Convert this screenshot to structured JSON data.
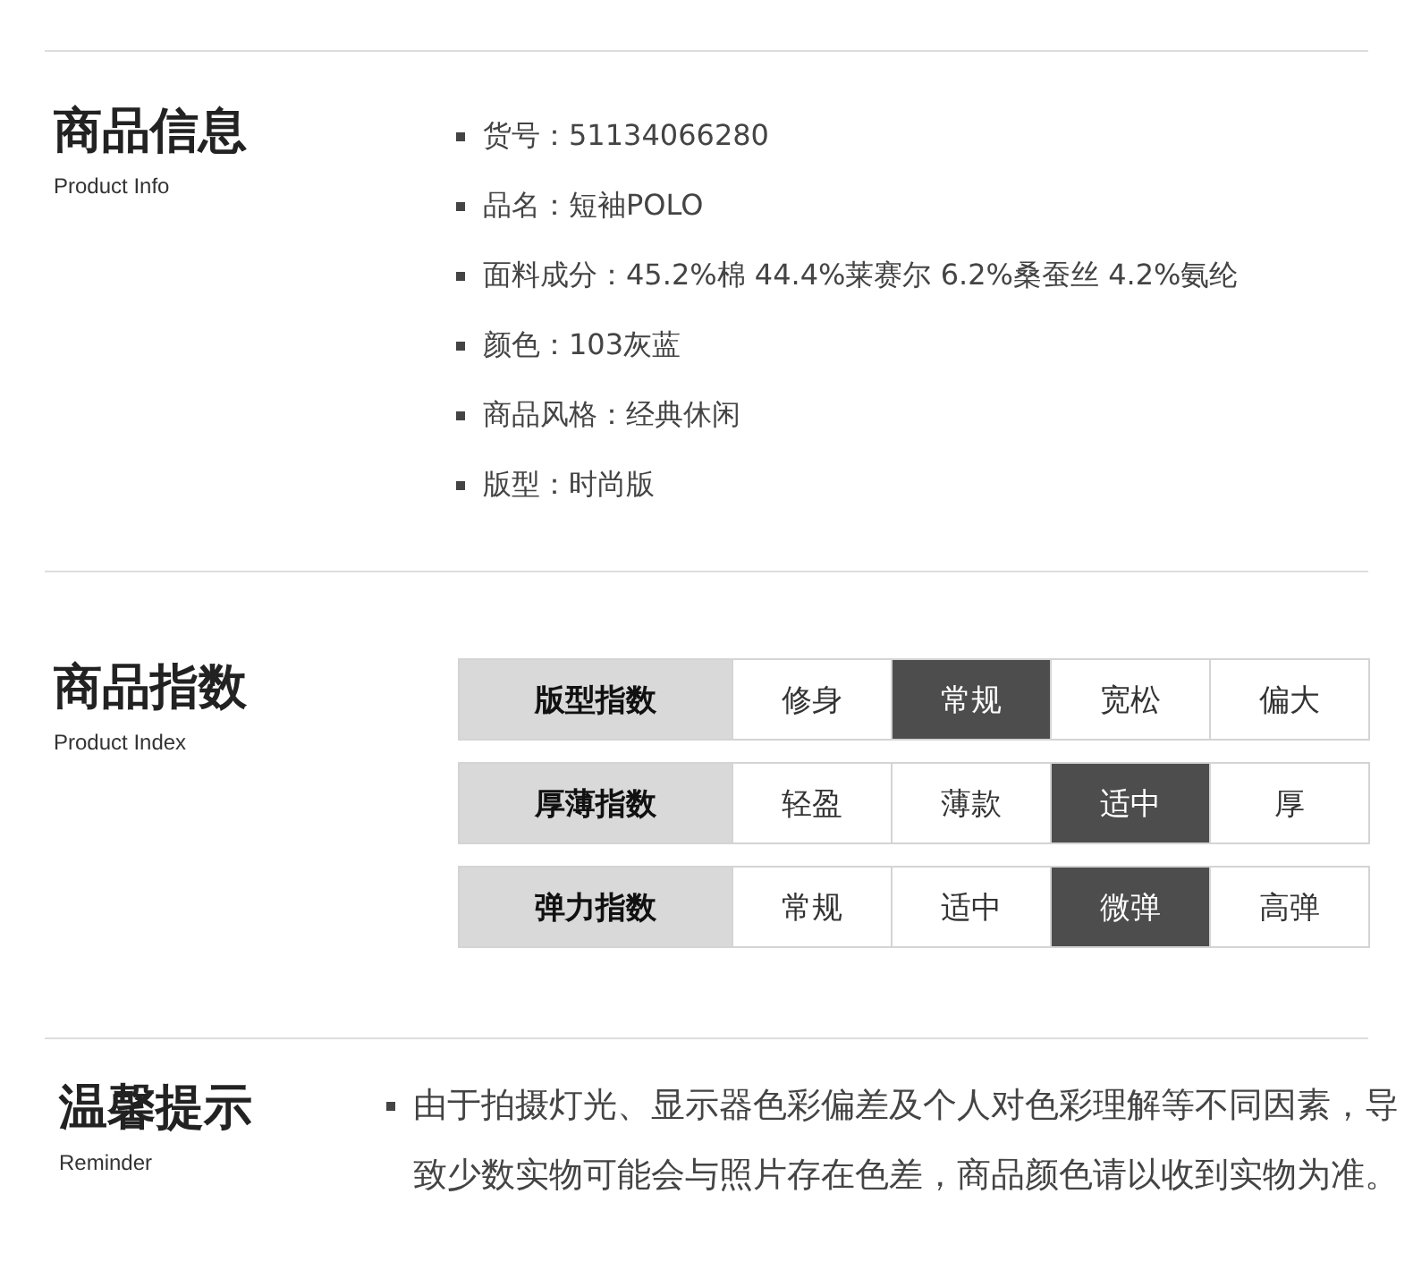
{
  "product_info": {
    "title": "商品信息",
    "subtitle": "Product Info",
    "items": [
      "货号：51134066280",
      "品名：短袖POLO",
      "面料成分：45.2%棉 44.4%莱赛尔 6.2%桑蚕丝 4.2%氨纶",
      "颜色：103灰蓝",
      "商品风格：经典休闲",
      "版型：时尚版"
    ]
  },
  "product_index": {
    "title": "商品指数",
    "subtitle": "Product Index",
    "rows": [
      {
        "label": "版型指数",
        "options": [
          {
            "text": "修身",
            "selected": false
          },
          {
            "text": "常规",
            "selected": true
          },
          {
            "text": "宽松",
            "selected": false
          },
          {
            "text": "偏大",
            "selected": false
          }
        ]
      },
      {
        "label": "厚薄指数",
        "options": [
          {
            "text": "轻盈",
            "selected": false
          },
          {
            "text": "薄款",
            "selected": false
          },
          {
            "text": "适中",
            "selected": true
          },
          {
            "text": "厚",
            "selected": false
          }
        ]
      },
      {
        "label": "弹力指数",
        "options": [
          {
            "text": "常规",
            "selected": false
          },
          {
            "text": "适中",
            "selected": false
          },
          {
            "text": "微弹",
            "selected": true
          },
          {
            "text": "高弹",
            "selected": false
          }
        ]
      }
    ]
  },
  "reminder": {
    "title": "温馨提示",
    "subtitle": "Reminder",
    "text": "由于拍摄灯光、显示器色彩偏差及个人对色彩理解等不同因素，导致少数实物可能会与照片存在色差，商品颜色请以收到实物为准。"
  }
}
